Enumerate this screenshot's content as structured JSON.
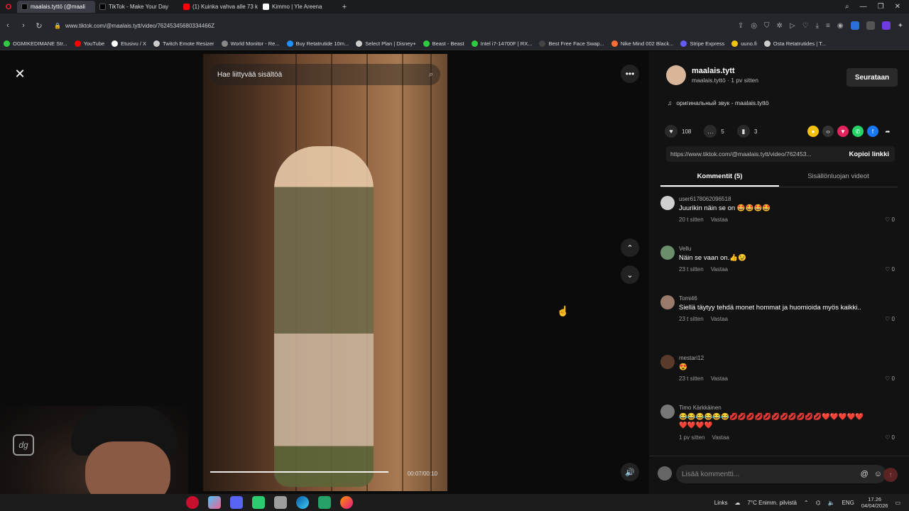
{
  "browser": {
    "tabs": [
      {
        "label": "maalais.tyttö (@maali",
        "active": true,
        "color": "#ffffff"
      },
      {
        "label": "TikTok - Make Your Day",
        "active": false,
        "color": "#ffffff"
      },
      {
        "label": "(1) Kuinka vahva alle 73 k",
        "active": false,
        "color": "#ff2a2a"
      },
      {
        "label": "Kimmo | Yle Areena",
        "active": false,
        "color": "#ffffff"
      }
    ],
    "url": "www.tiktok.com/@maalais.tytt/video/76245345680334466Z",
    "bookmarks": [
      {
        "label": "OGMIKEDIMANE Str...",
        "color": "#2ecc40"
      },
      {
        "label": "YouTube",
        "color": "#ff0000"
      },
      {
        "label": "Etusivu / X",
        "color": "#ffffff"
      },
      {
        "label": "Twitch Emote Resizer",
        "color": "#cccccc"
      },
      {
        "label": "World Monitor - Re...",
        "color": "#888888"
      },
      {
        "label": "Buy Retatrutide 10m...",
        "color": "#1e90ff"
      },
      {
        "label": "Select Plan | Disney+",
        "color": "#cccccc"
      },
      {
        "label": "Beast - Beast",
        "color": "#2ecc40"
      },
      {
        "label": "Intel i7-14700F | RX...",
        "color": "#2ecc40"
      },
      {
        "label": "Best Free Face Swap...",
        "color": "#444444"
      },
      {
        "label": "Nike Mind 002 Black...",
        "color": "#ff6b35"
      },
      {
        "label": "Stripe Express",
        "color": "#635bff"
      },
      {
        "label": "uuno.fi",
        "color": "#f1c40f"
      },
      {
        "label": "Osta Retatrutides | T...",
        "color": "#cccccc"
      }
    ]
  },
  "video": {
    "search_placeholder": "Hae liittyvää sisältöä",
    "progress": 0.73,
    "time": "00:07/00:10"
  },
  "panel": {
    "author_name": "maalais.tytt",
    "author_sub": "maalais.tyttö · 1 pv sitten",
    "follow_label": "Seurataan",
    "music": "оригинальный звук - maalais.tyttö",
    "likes": "108",
    "comments_count": "5",
    "saves": "3",
    "link": "https://www.tiktok.com/@maalais.tytt/video/762453...",
    "copy_label": "Kopioi linkki",
    "tab_comments": "Kommentit (5)",
    "tab_videos": "Sisällönluojan videot",
    "comment_placeholder": "Lisää kommentti..."
  },
  "comments": [
    {
      "user": "user6178062096518",
      "text": "Juurikin näin se on 🤩🤩🤩🤩",
      "time": "20 t sitten",
      "reply": "Vastaa",
      "likes": "0",
      "avatar_color": "#cfcfcf"
    },
    {
      "user": "Vellu",
      "text": "Näin se vaan on.👍😉",
      "time": "23 t sitten",
      "reply": "Vastaa",
      "likes": "0",
      "avatar_color": "#6b8e6b"
    },
    {
      "user": "Tomi46",
      "text": "Siellä täytyy tehdä monet hommat ja huomioida myös kaikki..",
      "time": "23 t sitten",
      "reply": "Vastaa",
      "likes": "0",
      "avatar_color": "#9a7a6a"
    },
    {
      "user": "mestari12",
      "text": "😍",
      "time": "23 t sitten",
      "reply": "Vastaa",
      "likes": "0",
      "avatar_color": "#5a3a2a"
    },
    {
      "user": "Timo Kärkkäinen",
      "text": "😂😂😂😂😂😂💋💋💋💋💋💋💋💋💋💋💋❤️❤️❤️❤️❤️❤️❤️❤️❤️",
      "time": "1 pv sitten",
      "reply": "Vastaa",
      "likes": "0",
      "avatar_color": "#777777"
    }
  ],
  "taskbar": {
    "links": "Links",
    "weather": "7°C  Enimm. pilvistä",
    "lang": "ENG",
    "time": "17.26",
    "date": "04/04/2026"
  }
}
